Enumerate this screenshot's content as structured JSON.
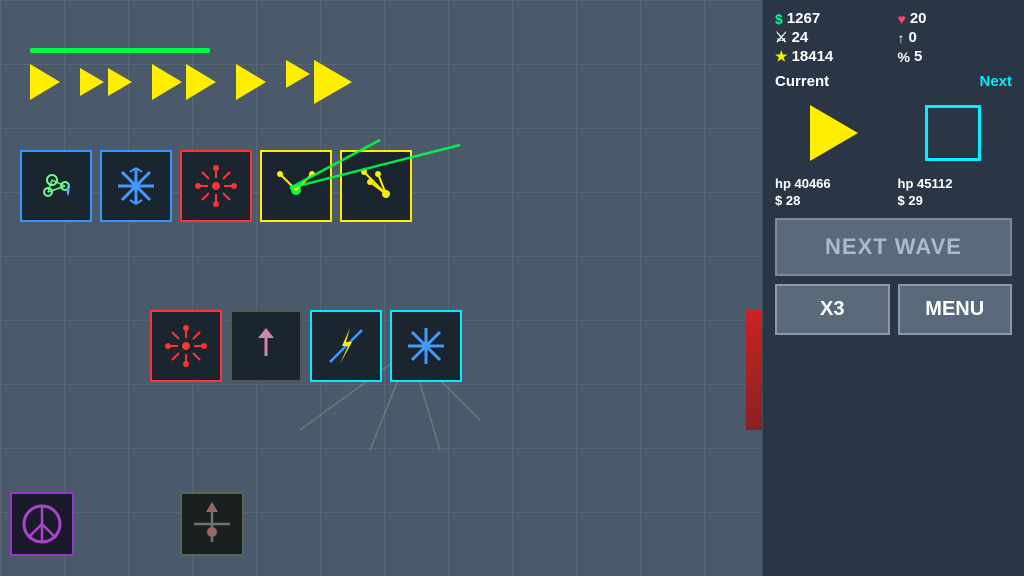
{
  "stats": {
    "money": "$ 1267",
    "hearts": "♥ 20",
    "sword": "24",
    "arrow": "0",
    "star": "18414",
    "percent": "% 5"
  },
  "current_next": {
    "current_label": "Current",
    "next_label": "Next"
  },
  "wave_info": {
    "current_hp": "hp 40466",
    "current_cost": "$ 28",
    "next_hp": "hp 45112",
    "next_cost": "$ 29"
  },
  "buttons": {
    "next_wave": "NEXT WAVE",
    "x3": "X3",
    "menu": "MENU"
  },
  "icons": {
    "money": "$",
    "heart": "♥",
    "sword": "⚔",
    "arrow": "↑",
    "star": "★",
    "percent": "%"
  }
}
